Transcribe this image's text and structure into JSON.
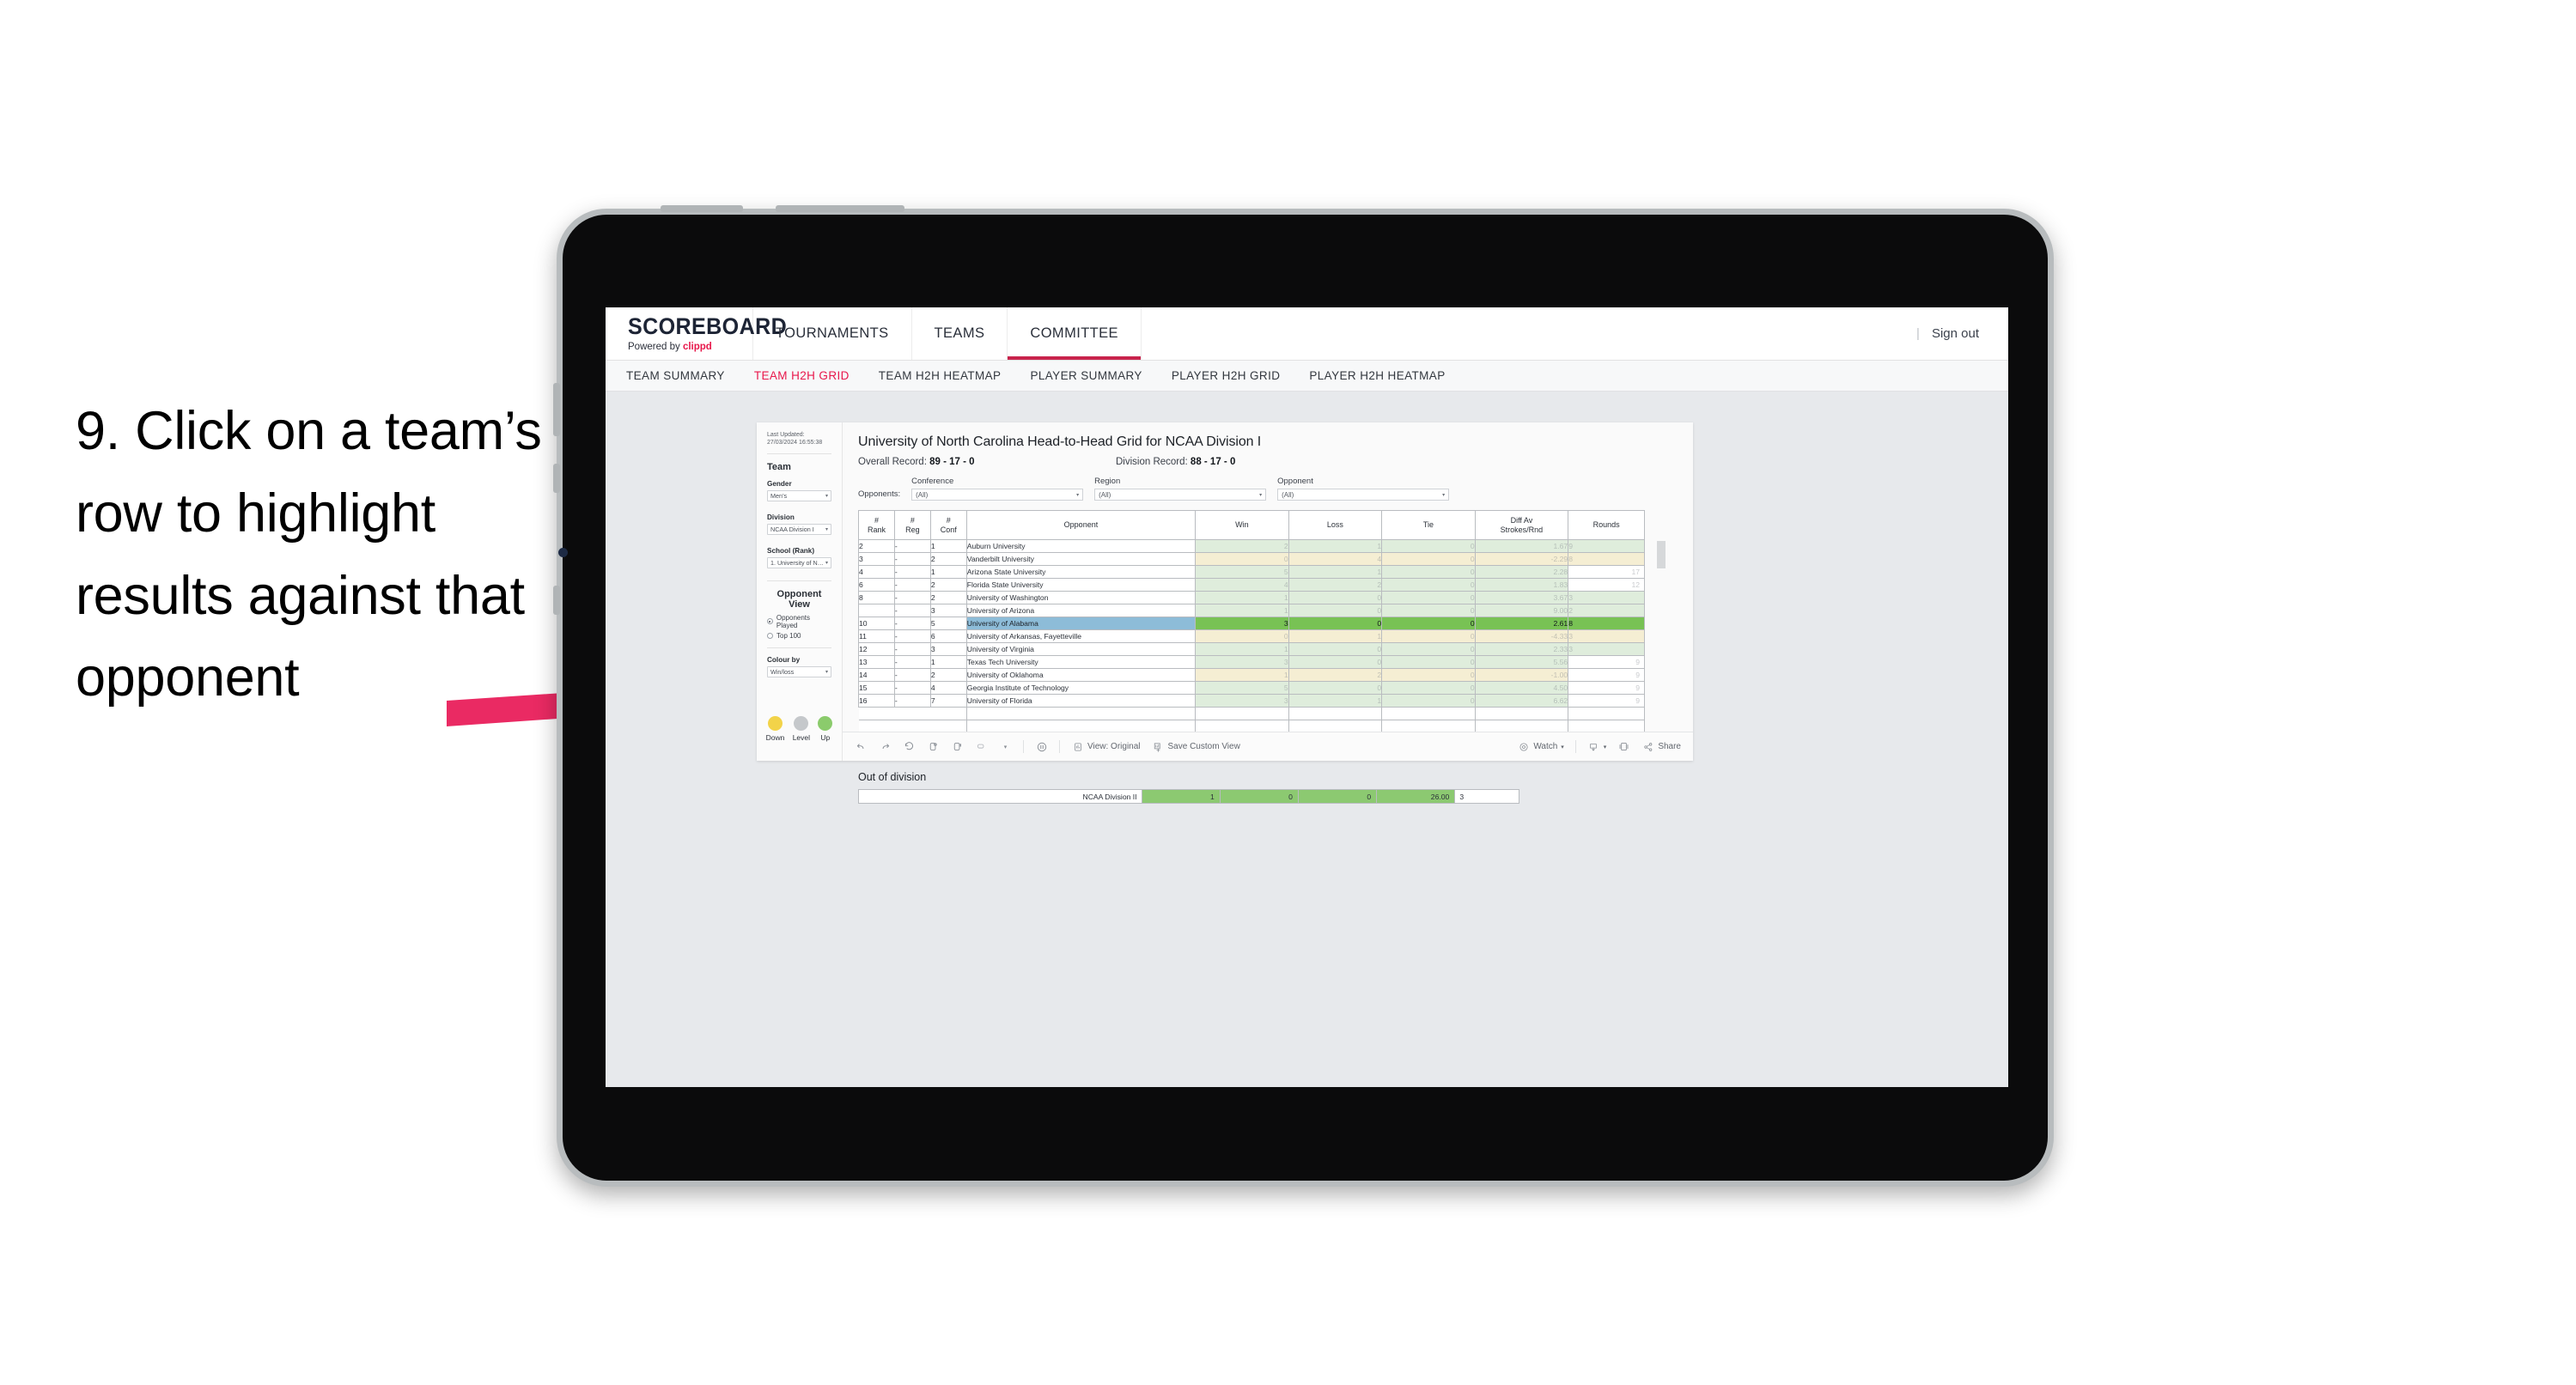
{
  "instruction": "9. Click on a team’s row to highlight results against that opponent",
  "brand": {
    "logo": "SCOREBOARD",
    "powered_prefix": "Powered by ",
    "powered_name": "clippd",
    "accent": "#e8174b"
  },
  "topnav": {
    "items": [
      {
        "label": "TOURNAMENTS",
        "active": false
      },
      {
        "label": "TEAMS",
        "active": false
      },
      {
        "label": "COMMITTEE",
        "active": true
      }
    ],
    "separator": "|",
    "sign_out": "Sign out"
  },
  "subnav": {
    "items": [
      {
        "label": "TEAM SUMMARY",
        "active": false
      },
      {
        "label": "TEAM H2H GRID",
        "active": true
      },
      {
        "label": "TEAM H2H HEATMAP",
        "active": false
      },
      {
        "label": "PLAYER SUMMARY",
        "active": false
      },
      {
        "label": "PLAYER H2H GRID",
        "active": false
      },
      {
        "label": "PLAYER H2H HEATMAP",
        "active": false
      }
    ]
  },
  "sidebar": {
    "last_updated": "Last Updated: 27/03/2024 16:55:38",
    "team_heading": "Team",
    "gender": {
      "label": "Gender",
      "value": "Men’s"
    },
    "division": {
      "label": "Division",
      "value": "NCAA Division I"
    },
    "school": {
      "label": "School (Rank)",
      "value": "1. University of Nort..."
    },
    "opponent_view": {
      "heading": "Opponent View",
      "options": [
        {
          "label": "Opponents Played",
          "selected": true
        },
        {
          "label": "Top 100",
          "selected": false
        }
      ]
    },
    "colour_by": {
      "label": "Colour by",
      "value": "Win/loss"
    },
    "legend": [
      {
        "label": "Down",
        "color": "#f2d349"
      },
      {
        "label": "Level",
        "color": "#c5c8cb"
      },
      {
        "label": "Up",
        "color": "#8bcb6c"
      }
    ]
  },
  "main": {
    "title": "University of North Carolina Head-to-Head Grid for NCAA Division I",
    "overall_record_label": "Overall Record: ",
    "overall_record_value": "89 - 17 - 0",
    "division_record_label": "Division Record: ",
    "division_record_value": "88 - 17 - 0",
    "filters": {
      "prefix": "Opponents:",
      "items": [
        {
          "label": "Conference",
          "value": "(All)"
        },
        {
          "label": "Region",
          "value": "(All)"
        },
        {
          "label": "Opponent",
          "value": "(All)"
        }
      ]
    },
    "out_of_division_title": "Out of division"
  },
  "chart_data": {
    "type": "table",
    "title": "University of North Carolina Head-to-Head Grid for NCAA Division I",
    "columns": [
      "# Rank",
      "# Reg",
      "# Conf",
      "Opponent",
      "Win",
      "Loss",
      "Tie",
      "Diff Av Strokes/Rnd",
      "Rounds"
    ],
    "header_cells": [
      {
        "l1": "#",
        "l2": "Rank"
      },
      {
        "l1": "#",
        "l2": "Reg"
      },
      {
        "l1": "#",
        "l2": "Conf"
      },
      {
        "l1": "Opponent",
        "l2": ""
      },
      {
        "l1": "Win",
        "l2": ""
      },
      {
        "l1": "Loss",
        "l2": ""
      },
      {
        "l1": "Tie",
        "l2": ""
      },
      {
        "l1": "Diff Av",
        "l2": "Strokes/Rnd"
      },
      {
        "l1": "Rounds",
        "l2": ""
      }
    ],
    "rows": [
      {
        "rank": "2",
        "reg": "-",
        "conf": "1",
        "opponent": "Auburn University",
        "win": "2",
        "loss": "1",
        "tie": "0",
        "diff": "1.67",
        "rounds": "9",
        "tint": "green",
        "highlight": false,
        "rounds_indent": false
      },
      {
        "rank": "3",
        "reg": "-",
        "conf": "2",
        "opponent": "Vanderbilt University",
        "win": "0",
        "loss": "4",
        "tie": "0",
        "diff": "-2.29",
        "rounds": "8",
        "tint": "yellow",
        "highlight": false,
        "rounds_indent": false
      },
      {
        "rank": "4",
        "reg": "-",
        "conf": "1",
        "opponent": "Arizona State University",
        "win": "5",
        "loss": "1",
        "tie": "0",
        "diff": "2.28",
        "rounds": "17",
        "tint": "green",
        "highlight": false,
        "rounds_indent": true
      },
      {
        "rank": "6",
        "reg": "-",
        "conf": "2",
        "opponent": "Florida State University",
        "win": "4",
        "loss": "2",
        "tie": "0",
        "diff": "1.83",
        "rounds": "12",
        "tint": "green",
        "highlight": false,
        "rounds_indent": true
      },
      {
        "rank": "8",
        "reg": "-",
        "conf": "2",
        "opponent": "University of Washington",
        "win": "1",
        "loss": "0",
        "tie": "0",
        "diff": "3.67",
        "rounds": "3",
        "tint": "green",
        "highlight": false,
        "rounds_indent": false
      },
      {
        "rank": "",
        "reg": "-",
        "conf": "3",
        "opponent": "University of Arizona",
        "win": "1",
        "loss": "0",
        "tie": "0",
        "diff": "9.00",
        "rounds": "2",
        "tint": "green",
        "highlight": false,
        "rounds_indent": false
      },
      {
        "rank": "10",
        "reg": "-",
        "conf": "5",
        "opponent": "University of Alabama",
        "win": "3",
        "loss": "0",
        "tie": "0",
        "diff": "2.61",
        "rounds": "8",
        "tint": "green",
        "highlight": true,
        "rounds_indent": false
      },
      {
        "rank": "11",
        "reg": "-",
        "conf": "6",
        "opponent": "University of Arkansas, Fayetteville",
        "win": "0",
        "loss": "1",
        "tie": "0",
        "diff": "-4.33",
        "rounds": "3",
        "tint": "yellow",
        "highlight": false,
        "rounds_indent": false
      },
      {
        "rank": "12",
        "reg": "-",
        "conf": "3",
        "opponent": "University of Virginia",
        "win": "1",
        "loss": "0",
        "tie": "0",
        "diff": "2.33",
        "rounds": "3",
        "tint": "green",
        "highlight": false,
        "rounds_indent": false
      },
      {
        "rank": "13",
        "reg": "-",
        "conf": "1",
        "opponent": "Texas Tech University",
        "win": "3",
        "loss": "0",
        "tie": "0",
        "diff": "5.56",
        "rounds": "9",
        "tint": "green",
        "highlight": false,
        "rounds_indent": true
      },
      {
        "rank": "14",
        "reg": "-",
        "conf": "2",
        "opponent": "University of Oklahoma",
        "win": "1",
        "loss": "2",
        "tie": "0",
        "diff": "-1.00",
        "rounds": "9",
        "tint": "yellow",
        "highlight": false,
        "rounds_indent": true
      },
      {
        "rank": "15",
        "reg": "-",
        "conf": "4",
        "opponent": "Georgia Institute of Technology",
        "win": "5",
        "loss": "0",
        "tie": "0",
        "diff": "4.50",
        "rounds": "9",
        "tint": "green",
        "highlight": false,
        "rounds_indent": true
      },
      {
        "rank": "16",
        "reg": "-",
        "conf": "7",
        "opponent": "University of Florida",
        "win": "3",
        "loss": "1",
        "tie": "0",
        "diff": "6.62",
        "rounds": "9",
        "tint": "green",
        "highlight": false,
        "rounds_indent": true
      }
    ],
    "out_of_division": {
      "name": "NCAA Division II",
      "win": "1",
      "loss": "0",
      "tie": "0",
      "diff": "26.00",
      "rounds": "3"
    }
  },
  "toolbar": {
    "view_original": "View: Original",
    "save_custom_view": "Save Custom View",
    "watch": "Watch",
    "share": "Share"
  }
}
